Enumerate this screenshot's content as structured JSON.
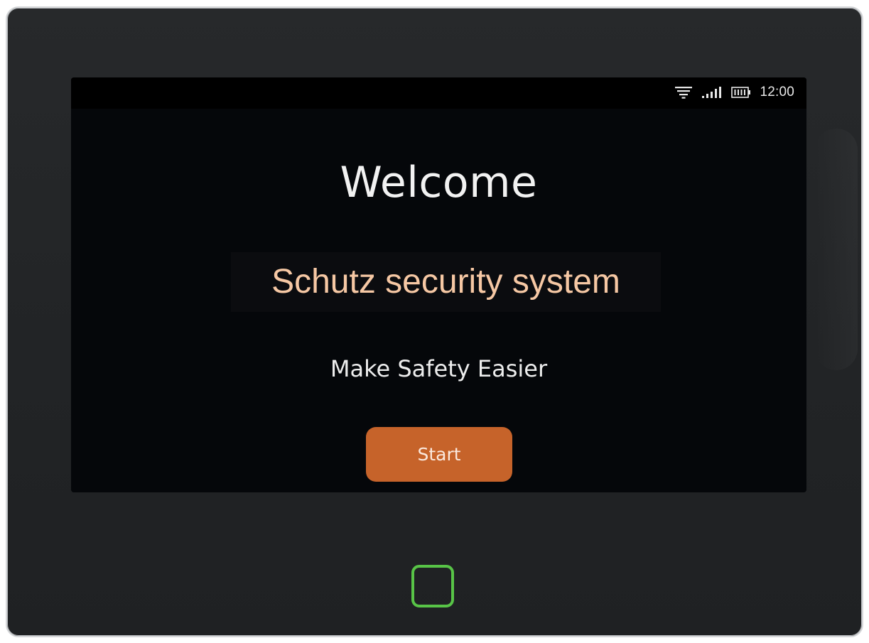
{
  "status_bar": {
    "icons": [
      "wifi-icon",
      "signal-icon",
      "battery-icon"
    ],
    "time": "12:00"
  },
  "welcome": {
    "title": "Welcome",
    "brand": "Schutz security system",
    "tagline": "Make Safety Easier",
    "start_label": "Start"
  },
  "device": {
    "home_key_icon": "home-key-square"
  },
  "colors": {
    "bezel": "#242628",
    "screen": "#05070a",
    "brand_text": "#f6c8a4",
    "start_button": "#c6632a",
    "home_key": "#58c447"
  }
}
